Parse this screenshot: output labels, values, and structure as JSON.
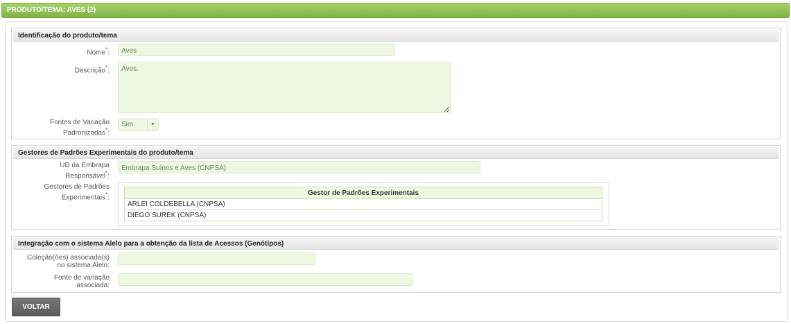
{
  "page": {
    "title": "PRODUTO/TEMA: AVES (2)"
  },
  "identificacao": {
    "heading": "Identificação do produto/tema",
    "nome_label": "Nome",
    "nome_value": "Aves",
    "descricao_label": "Descrição",
    "descricao_value": "Aves.",
    "fontes_label_line1": "Fontes de Variação",
    "fontes_label_line2": "Padronizadas",
    "fontes_value": "Sim",
    "required_mark": "*",
    "colon": ":"
  },
  "gestores": {
    "heading": "Gestores de Padrões Experimentais do produto/tema",
    "ud_label_line1": "UD da Embrapa",
    "ud_label_line2": "Responsável",
    "ud_value": "Embrapa Suínos e Aves (CNPSA)",
    "gp_label_line1": "Gestores de Padrões",
    "gp_label_line2": "Experimentais",
    "table_header": "Gestor de Padrões Experimentais",
    "rows": [
      "ARLEI COLDEBELLA (CNPSA)",
      "DIEGO SUREK (CNPSA)"
    ]
  },
  "integracao": {
    "heading": "Integração com o sistema Alelo para a obtenção da lista de Acessos (Genótipos)",
    "colecao_label_line1": "Coleção(ões) associada(s)",
    "colecao_label_line2": "no sistema Alelo:",
    "colecao_value": "",
    "fonte_label_line1": "Fonte de variação",
    "fonte_label_line2": "associada:",
    "fonte_value": ""
  },
  "actions": {
    "voltar_label": "VOLTAR"
  }
}
